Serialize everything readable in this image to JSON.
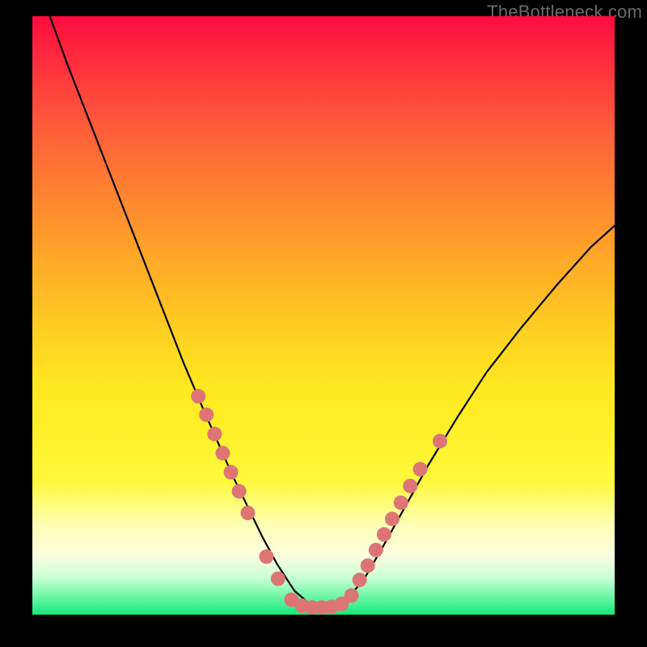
{
  "watermark": "TheBottleneck.com",
  "chart_data": {
    "type": "line",
    "title": "",
    "xlabel": "",
    "ylabel": "",
    "xlim": [
      0,
      100
    ],
    "ylim": [
      0,
      100
    ],
    "grid": false,
    "legend": false,
    "series": [
      {
        "name": "curve",
        "x": [
          3,
          6,
          10,
          14,
          18,
          22,
          26,
          29.5,
          32,
          34.5,
          37,
          39.5,
          42,
          45,
          48,
          51,
          54,
          57,
          60,
          64,
          68,
          73,
          78,
          84,
          90,
          96,
          100
        ],
        "y": [
          100,
          92,
          82,
          72,
          62,
          52,
          42,
          34,
          28.5,
          23,
          18,
          13,
          8.5,
          4,
          1.5,
          1.2,
          2.5,
          6,
          11,
          18,
          25,
          33,
          40.5,
          48,
          55,
          61.5,
          65
        ],
        "color": "#000000",
        "linewidth": 2.2
      }
    ],
    "markers": [
      {
        "name": "dots-left",
        "x": [
          28.5,
          29.9,
          31.3,
          32.7,
          34.1,
          35.5,
          37.0,
          40.2,
          42.2
        ],
        "y": [
          36.5,
          33.4,
          30.2,
          27.0,
          23.8,
          20.6,
          17.0,
          9.7,
          6.0
        ],
        "r": 9,
        "color": "#de7575"
      },
      {
        "name": "dots-bottom",
        "x": [
          44.5,
          46.3,
          48.0,
          49.7,
          51.4,
          53.1,
          54.8
        ],
        "y": [
          2.5,
          1.5,
          1.2,
          1.2,
          1.3,
          1.8,
          3.2
        ],
        "r": 9,
        "color": "#de7575"
      },
      {
        "name": "dots-right",
        "x": [
          56.2,
          57.6,
          59.0,
          60.4,
          61.8,
          63.3,
          64.9,
          66.6,
          70.0
        ],
        "y": [
          5.8,
          8.2,
          10.8,
          13.4,
          16.0,
          18.7,
          21.5,
          24.3,
          29.0
        ],
        "r": 9,
        "color": "#de7575"
      }
    ],
    "background_gradient_stops": [
      {
        "pos": 0,
        "color": "#ff0b3e"
      },
      {
        "pos": 8,
        "color": "#ff2f3e"
      },
      {
        "pos": 18,
        "color": "#ff5a3b"
      },
      {
        "pos": 30,
        "color": "#ff8431"
      },
      {
        "pos": 42,
        "color": "#ffad27"
      },
      {
        "pos": 54,
        "color": "#ffd322"
      },
      {
        "pos": 62,
        "color": "#ffe822"
      },
      {
        "pos": 70,
        "color": "#fff12a"
      },
      {
        "pos": 78,
        "color": "#fff93f"
      },
      {
        "pos": 85,
        "color": "#feffb5"
      },
      {
        "pos": 90,
        "color": "#fdffe1"
      },
      {
        "pos": 94,
        "color": "#c6ffd4"
      },
      {
        "pos": 97,
        "color": "#6cf7a4"
      },
      {
        "pos": 100,
        "color": "#14e87b"
      }
    ]
  }
}
